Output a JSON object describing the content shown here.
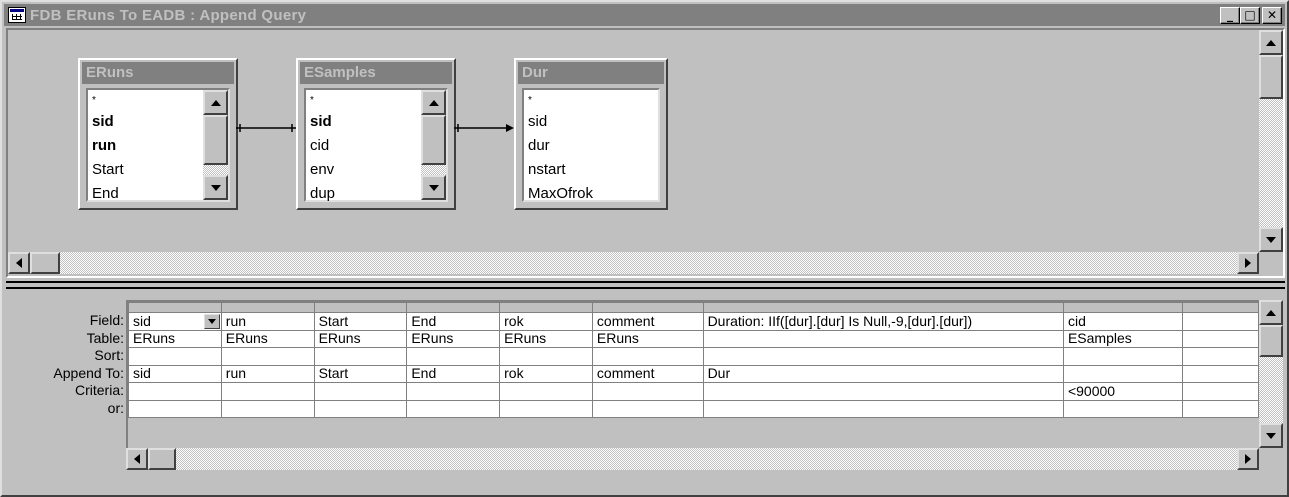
{
  "window": {
    "title": "FDB ERuns To EADB : Append Query",
    "buttons": {
      "minimize": "_",
      "maximize": "□",
      "close": "✕"
    }
  },
  "field_lists": [
    {
      "name": "ERuns",
      "items": [
        {
          "label": "*",
          "key": false
        },
        {
          "label": "sid",
          "key": true
        },
        {
          "label": "run",
          "key": true
        },
        {
          "label": "Start",
          "key": false
        },
        {
          "label": "End",
          "key": false
        }
      ]
    },
    {
      "name": "ESamples",
      "items": [
        {
          "label": "*",
          "key": false
        },
        {
          "label": "sid",
          "key": true
        },
        {
          "label": "cid",
          "key": false
        },
        {
          "label": "env",
          "key": false
        },
        {
          "label": "dup",
          "key": false
        }
      ]
    },
    {
      "name": "Dur",
      "items": [
        {
          "label": "*",
          "key": false
        },
        {
          "label": "sid",
          "key": false
        },
        {
          "label": "dur",
          "key": false
        },
        {
          "label": "nstart",
          "key": false
        },
        {
          "label": "MaxOfrok",
          "key": false
        }
      ]
    }
  ],
  "grid": {
    "row_labels": [
      "Field:",
      "Table:",
      "Sort:",
      "Append To:",
      "Criteria:",
      "or:"
    ],
    "columns": [
      {
        "field": "sid",
        "table": "ERuns",
        "sort": "",
        "append_to": "sid",
        "criteria": "",
        "or": ""
      },
      {
        "field": "run",
        "table": "ERuns",
        "sort": "",
        "append_to": "run",
        "criteria": "",
        "or": ""
      },
      {
        "field": "Start",
        "table": "ERuns",
        "sort": "",
        "append_to": "Start",
        "criteria": "",
        "or": ""
      },
      {
        "field": "End",
        "table": "ERuns",
        "sort": "",
        "append_to": "End",
        "criteria": "",
        "or": ""
      },
      {
        "field": "rok",
        "table": "ERuns",
        "sort": "",
        "append_to": "rok",
        "criteria": "",
        "or": ""
      },
      {
        "field": "comment",
        "table": "ERuns",
        "sort": "",
        "append_to": "comment",
        "criteria": "",
        "or": ""
      },
      {
        "field": "Duration: IIf([dur].[dur] Is Null,-9,[dur].[dur])",
        "table": "",
        "sort": "",
        "append_to": "Dur",
        "criteria": "",
        "or": ""
      },
      {
        "field": "cid",
        "table": "ESamples",
        "sort": "",
        "append_to": "",
        "criteria": "<90000",
        "or": ""
      },
      {
        "field": "",
        "table": "",
        "sort": "",
        "append_to": "",
        "criteria": "",
        "or": ""
      }
    ]
  }
}
